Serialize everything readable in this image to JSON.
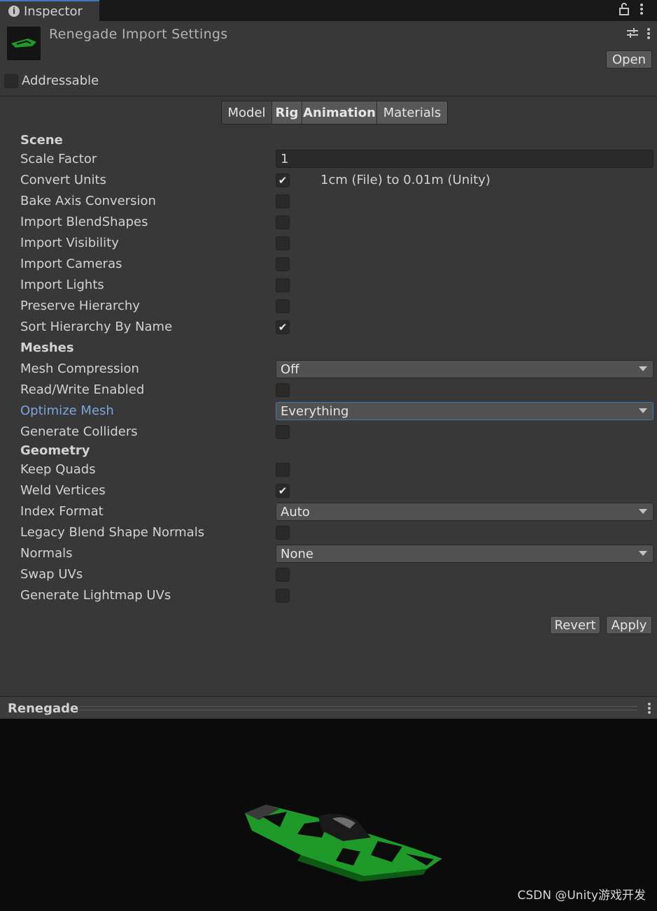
{
  "window": {
    "tab_label": "Inspector",
    "tab_icon": "info-icon"
  },
  "header": {
    "title": "Renegade Import Settings",
    "open_label": "Open",
    "addressable_label": "Addressable",
    "addressable_checked": false
  },
  "tabs": [
    {
      "label": "Model",
      "active": true
    },
    {
      "label": "Rig",
      "active": false
    },
    {
      "label": "Animation",
      "active": false
    },
    {
      "label": "Materials",
      "active": false
    }
  ],
  "scene": {
    "heading": "Scene",
    "scale_factor_label": "Scale Factor",
    "scale_factor_value": "1",
    "convert_units_label": "Convert Units",
    "convert_units_note": "1cm (File) to 0.01m (Unity)",
    "bake_axis_label": "Bake Axis Conversion",
    "blendshapes_label": "Import BlendShapes",
    "visibility_label": "Import Visibility",
    "cameras_label": "Import Cameras",
    "lights_label": "Import Lights",
    "preserve_hierarchy_label": "Preserve Hierarchy",
    "sort_hierarchy_label": "Sort Hierarchy By Name"
  },
  "meshes": {
    "heading": "Meshes",
    "compression_label": "Mesh Compression",
    "compression_value": "Off",
    "read_write_label": "Read/Write Enabled",
    "optimize_label": "Optimize Mesh",
    "optimize_value": "Everything",
    "colliders_label": "Generate Colliders"
  },
  "geometry": {
    "heading": "Geometry",
    "keep_quads_label": "Keep Quads",
    "weld_vertices_label": "Weld Vertices",
    "index_format_label": "Index Format",
    "index_format_value": "Auto",
    "legacy_normals_label": "Legacy Blend Shape Normals",
    "normals_label": "Normals",
    "normals_value": "None",
    "swap_uvs_label": "Swap UVs",
    "lightmap_uvs_label": "Generate Lightmap UVs"
  },
  "actions": {
    "revert_label": "Revert",
    "apply_label": "Apply"
  },
  "preview": {
    "title": "Renegade",
    "watermark": "CSDN @Unity游戏开发"
  },
  "colors": {
    "background": "#383838",
    "accent": "#3a79bb",
    "highlight_label": "#7ba6de",
    "boat_green": "#1f9a2a"
  }
}
